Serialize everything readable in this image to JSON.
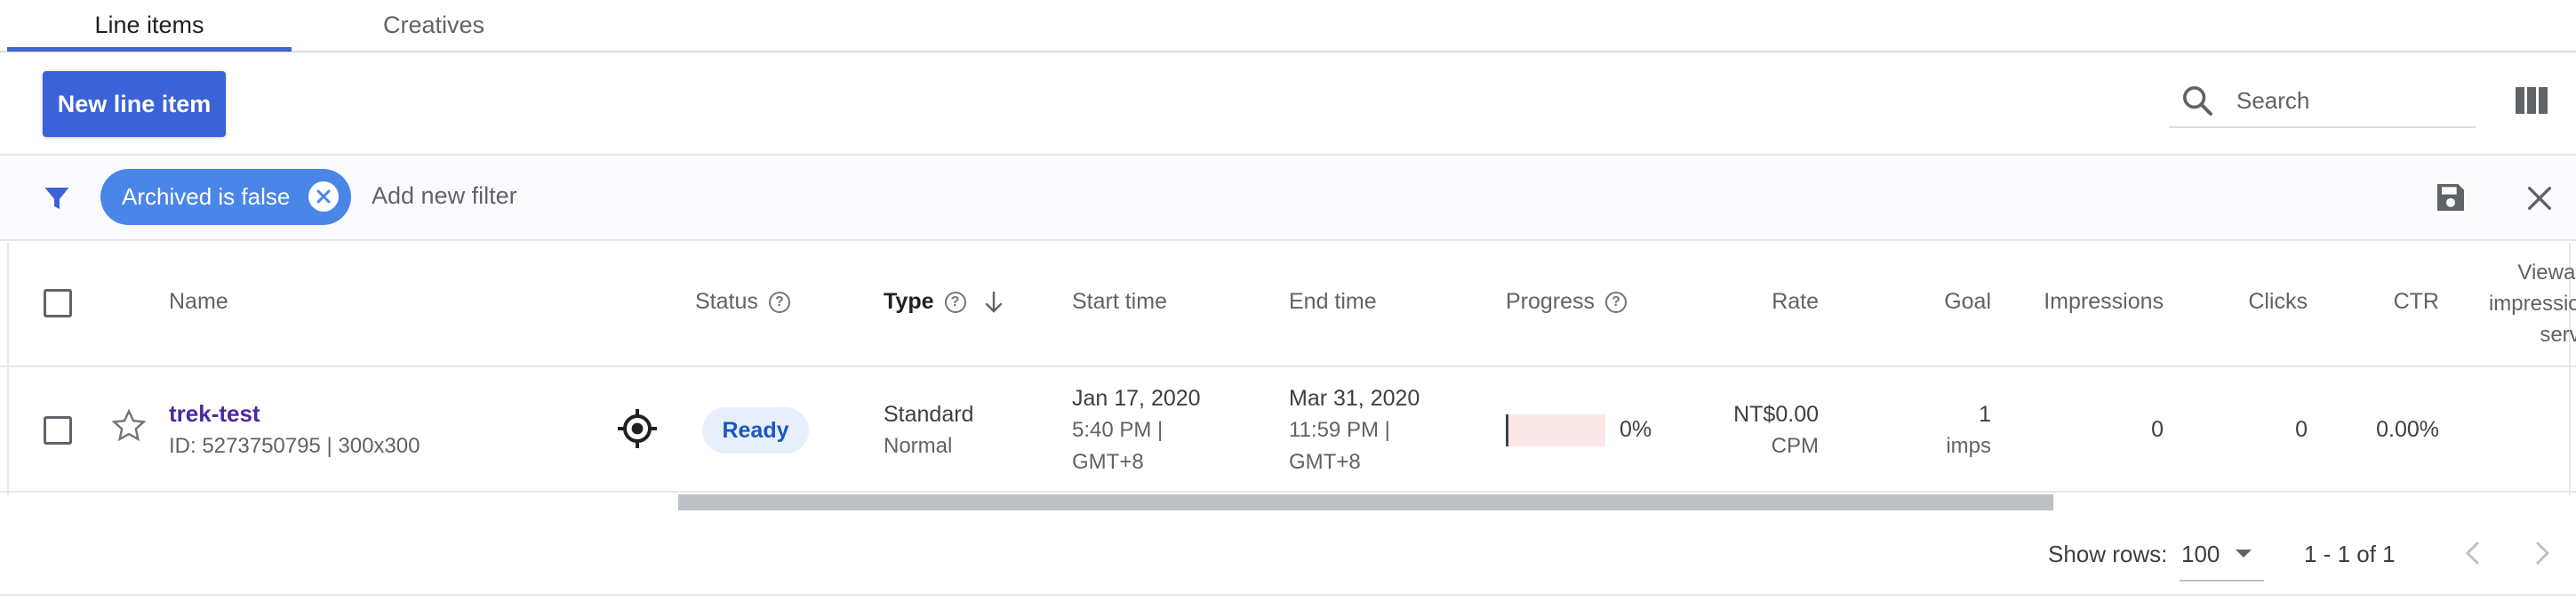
{
  "tabs": [
    {
      "label": "Line items",
      "active": true
    },
    {
      "label": "Creatives",
      "active": false
    }
  ],
  "toolbar": {
    "new_button_label": "New line item",
    "search_placeholder": "Search"
  },
  "filters": {
    "chips": [
      {
        "label": "Archived is false"
      }
    ],
    "add_filter_label": "Add new filter"
  },
  "table": {
    "headers": {
      "name": "Name",
      "status": "Status",
      "type": "Type",
      "start_time": "Start time",
      "end_time": "End time",
      "progress": "Progress",
      "rate": "Rate",
      "goal": "Goal",
      "impressions": "Impressions",
      "clicks": "Clicks",
      "ctr": "CTR",
      "viewable_line1": "Viewabl",
      "viewable_line2": "impression",
      "viewable_line3": "serve"
    },
    "rows": [
      {
        "name": "trek-test",
        "id_line": "ID: 5273750795 | 300x300",
        "status": "Ready",
        "type": "Standard",
        "subtype": "Normal",
        "start_date": "Jan 17, 2020",
        "start_time": "5:40 PM |",
        "start_tz": "GMT+8",
        "end_date": "Mar 31, 2020",
        "end_time": "11:59 PM |",
        "end_tz": "GMT+8",
        "progress": "0%",
        "progress_fraction": 0,
        "rate": "NT$0.00",
        "rate_unit": "CPM",
        "goal": "1",
        "goal_unit": "imps",
        "impressions": "0",
        "clicks": "0",
        "ctr": "0.00%"
      }
    ]
  },
  "footer": {
    "show_rows_label": "Show rows:",
    "rows_per_page": "100",
    "range": "1 - 1 of 1"
  },
  "colors": {
    "primary": "#3b62d6",
    "chip": "#4a86e8",
    "link": "#4a28a8",
    "badge_bg": "#e8effc",
    "progress_track": "#fbe7e7"
  }
}
